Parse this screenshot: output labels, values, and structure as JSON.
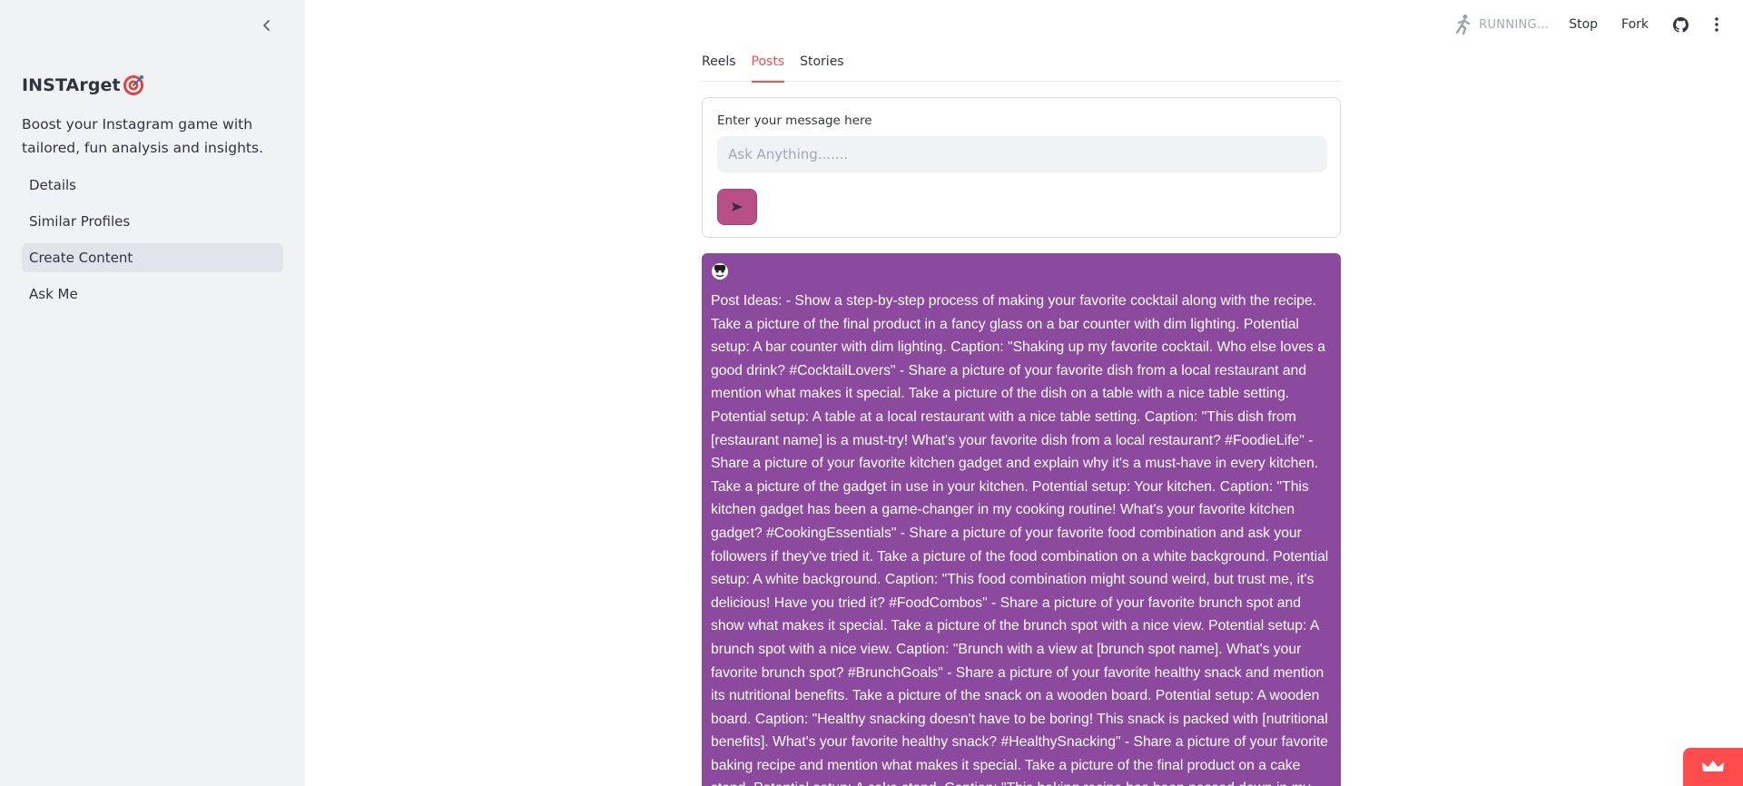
{
  "sidebar": {
    "title": "INSTArget",
    "title_emoji": "direct-hit-icon",
    "description": "Boost your Instagram game with tailored, fun analysis and insights.",
    "nav_items": [
      {
        "label": "Details",
        "active": false
      },
      {
        "label": "Similar Profiles",
        "active": false
      },
      {
        "label": "Create Content",
        "active": true
      },
      {
        "label": "Ask Me",
        "active": false
      }
    ]
  },
  "toolbar": {
    "status": "RUNNING...",
    "stop_label": "Stop",
    "fork_label": "Fork",
    "icons": [
      "running-man-icon",
      "github-icon",
      "kebab-menu-icon"
    ]
  },
  "main": {
    "tabs": [
      {
        "label": "Reels",
        "active": false
      },
      {
        "label": "Posts",
        "active": true
      },
      {
        "label": "Stories",
        "active": false
      }
    ],
    "form": {
      "label": "Enter your message here",
      "placeholder": "Ask Anything.......",
      "value": "",
      "send_icon": "play-arrow-icon"
    },
    "response": {
      "avatar_icon": "bot-avatar-icon",
      "text": "Post Ideas: - Show a step-by-step process of making your favorite cocktail along with the recipe. Take a picture of the final product in a fancy glass on a bar counter with dim lighting. Potential setup: A bar counter with dim lighting. Caption: \"Shaking up my favorite cocktail. Who else loves a good drink? #CocktailLovers\" - Share a picture of your favorite dish from a local restaurant and mention what makes it special. Take a picture of the dish on a table with a nice table setting. Potential setup: A table at a local restaurant with a nice table setting. Caption: \"This dish from [restaurant name] is a must-try! What's your favorite dish from a local restaurant? #FoodieLife\" - Share a picture of your favorite kitchen gadget and explain why it's a must-have in every kitchen. Take a picture of the gadget in use in your kitchen. Potential setup: Your kitchen. Caption: \"This kitchen gadget has been a game-changer in my cooking routine! What's your favorite kitchen gadget? #CookingEssentials\" - Share a picture of your favorite food combination and ask your followers if they've tried it. Take a picture of the food combination on a white background. Potential setup: A white background. Caption: \"This food combination might sound weird, but trust me, it's delicious! Have you tried it? #FoodCombos\" - Share a picture of your favorite brunch spot and show what makes it special. Take a picture of the brunch spot with a nice view. Potential setup: A brunch spot with a nice view. Caption: \"Brunch with a view at [brunch spot name]. What's your favorite brunch spot? #BrunchGoals\" - Share a picture of your favorite healthy snack and mention its nutritional benefits. Take a picture of the snack on a wooden board. Potential setup: A wooden board. Caption: \"Healthy snacking doesn't have to be boring! This snack is packed with [nutritional benefits]. What's your favorite healthy snack? #HealthySnacking\" - Share a picture of your favorite baking recipe and mention what makes it special. Take a picture of the final product on a cake stand. Potential setup: A cake stand. Caption: \"This baking recipe has been passed down in my family for generations! What's your favorite baking recipe? #BakingTraditions\" - Share a"
    }
  },
  "colors": {
    "sidebar_bg": "#f0f2f6",
    "accent": "#ff4b4b",
    "response_bg": "#8b4a9e",
    "send_button": "#b84f86"
  },
  "corner_badge_icon": "crown-icon"
}
